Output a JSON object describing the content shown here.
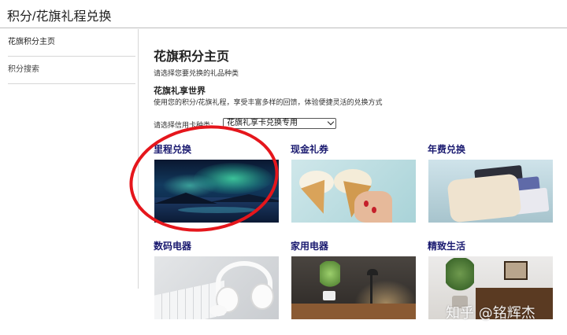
{
  "app": {
    "title": "积分/花旗礼程兑换"
  },
  "sidebar": {
    "items": [
      {
        "label": "花旗积分主页"
      },
      {
        "label": "积分搜索"
      }
    ]
  },
  "main": {
    "title": "花旗积分主页",
    "prompt": "请选择您要兑换的礼品种类",
    "subtitle": "花旗礼享世界",
    "description": "使用您的积分/花旗礼程，享受丰富多样的回馈，体验便捷灵活的兑换方式",
    "card_select": {
      "label": "请选择信用卡种类：",
      "value": "花旗礼享卡兑换专用"
    },
    "categories": [
      {
        "label": "里程兑换",
        "image": "aurora-photo"
      },
      {
        "label": "现金礼券",
        "image": "ice-cream-photo"
      },
      {
        "label": "年费兑换",
        "image": "wallet-cards-photo"
      },
      {
        "label": "数码电器",
        "image": "headphones-keyboard-photo"
      },
      {
        "label": "家用电器",
        "image": "desk-lamp-photo"
      },
      {
        "label": "精致生活",
        "image": "living-room-photo"
      }
    ]
  },
  "watermark": "知乎 @铭辉杰",
  "annotation_color": "#e5161c"
}
